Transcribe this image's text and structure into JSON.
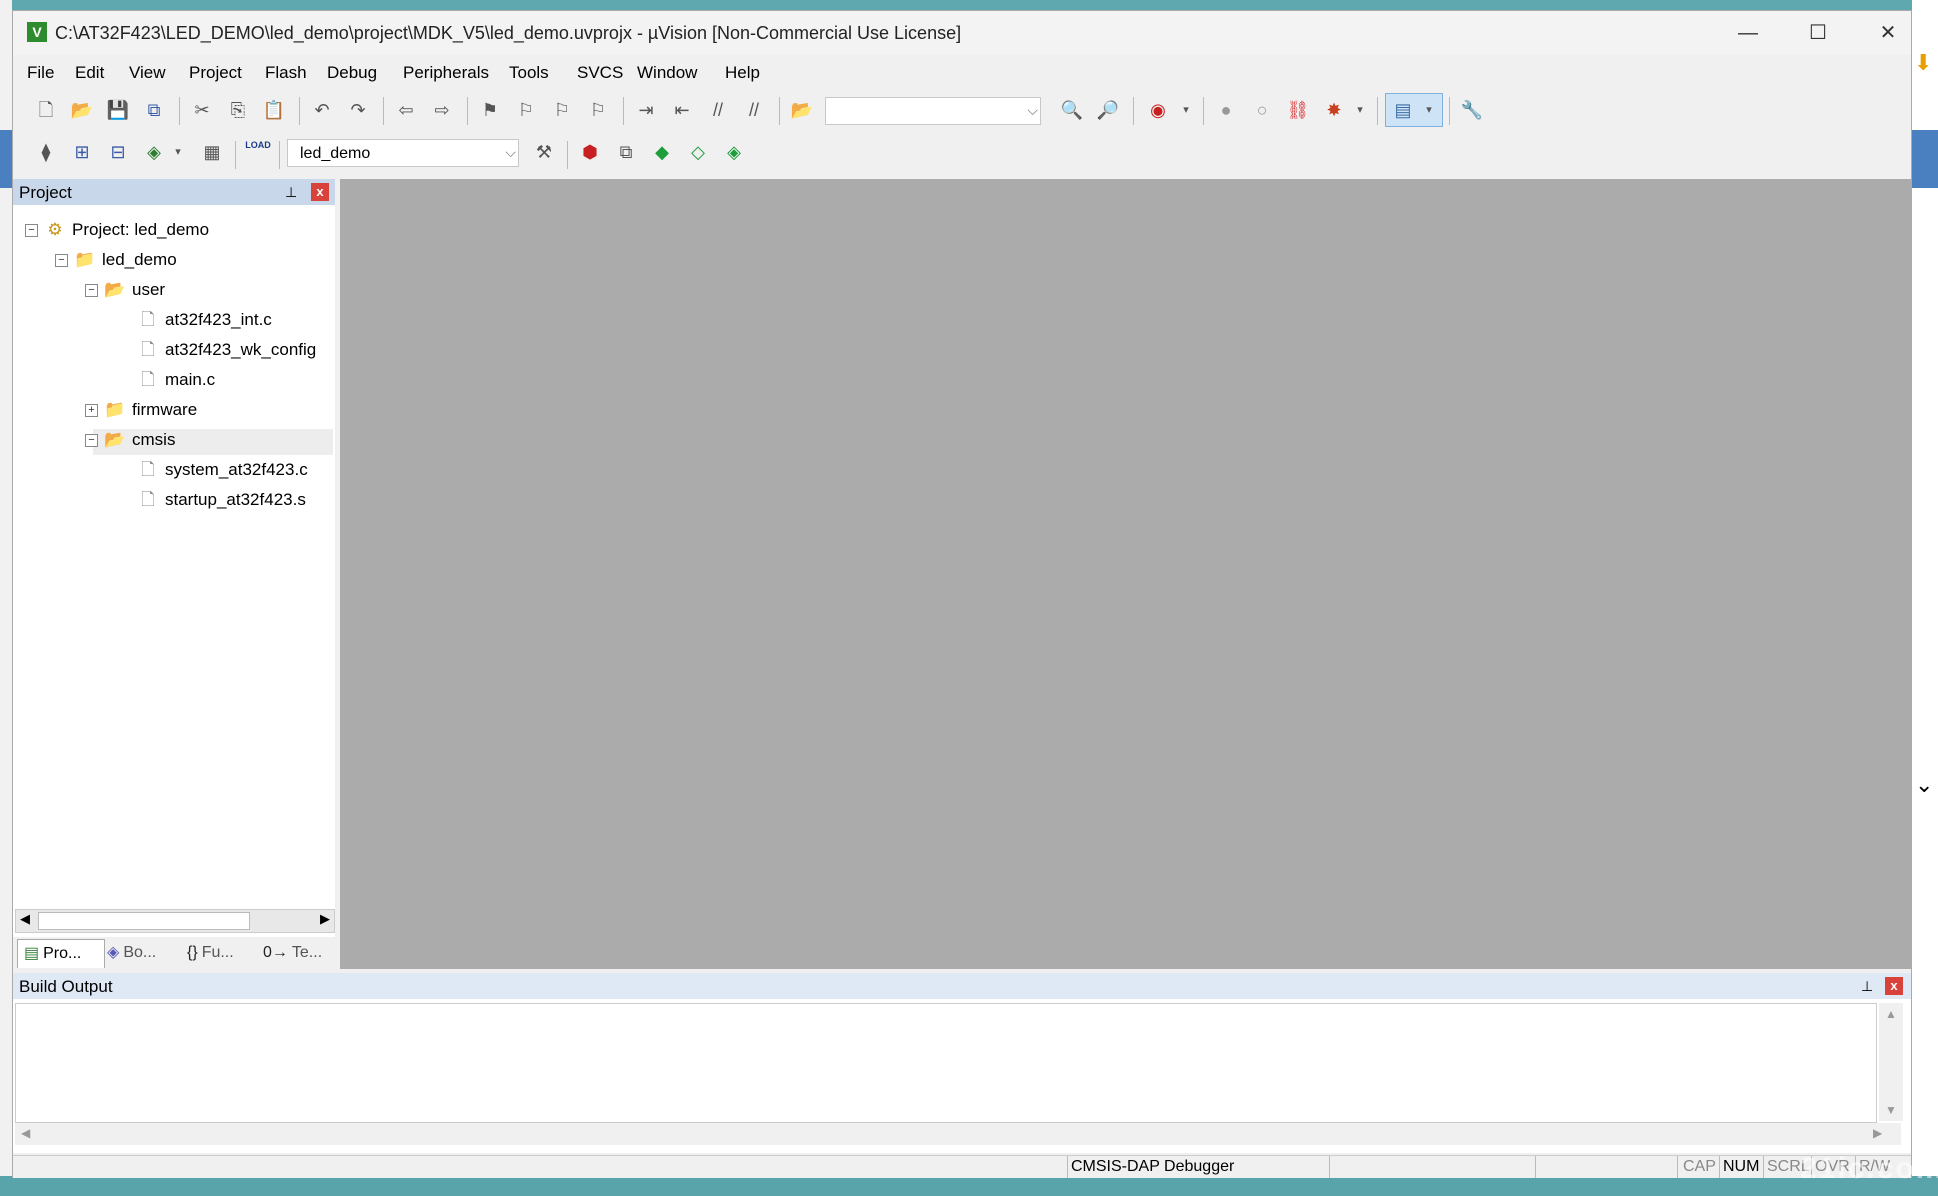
{
  "window": {
    "title": "C:\\AT32F423\\LED_DEMO\\led_demo\\project\\MDK_V5\\led_demo.uvprojx - µVision  [Non-Commercial Use License]",
    "icon": "V",
    "minimize": "—",
    "maximize": "☐",
    "close": "✕"
  },
  "menu": [
    "File",
    "Edit",
    "View",
    "Project",
    "Flash",
    "Debug",
    "Peripherals",
    "Tools",
    "SVCS",
    "Window",
    "Help"
  ],
  "toolbar": {
    "find_combo_value": "",
    "target_combo_value": "led_demo",
    "load_icon_text": "LOAD"
  },
  "project_panel": {
    "title": "Project",
    "pin": "📌",
    "close": "x",
    "tree": [
      {
        "label": "Project: led_demo",
        "exp": "−",
        "level": 0,
        "kind": "project"
      },
      {
        "label": "led_demo",
        "exp": "−",
        "level": 1,
        "kind": "target"
      },
      {
        "label": "user",
        "exp": "−",
        "level": 2,
        "kind": "folder"
      },
      {
        "label": "at32f423_int.c",
        "exp": "",
        "level": 3,
        "kind": "file"
      },
      {
        "label": "at32f423_wk_config",
        "exp": "",
        "level": 3,
        "kind": "file"
      },
      {
        "label": "main.c",
        "exp": "",
        "level": 3,
        "kind": "file"
      },
      {
        "label": "firmware",
        "exp": "+",
        "level": 2,
        "kind": "folder"
      },
      {
        "label": "cmsis",
        "exp": "−",
        "level": 2,
        "kind": "folder"
      },
      {
        "label": "system_at32f423.c",
        "exp": "",
        "level": 3,
        "kind": "file"
      },
      {
        "label": "startup_at32f423.s",
        "exp": "",
        "level": 3,
        "kind": "file"
      }
    ],
    "tabs": [
      {
        "label": "Pro...",
        "icon": "▤"
      },
      {
        "label": "Bo...",
        "icon": "◈"
      },
      {
        "label": "Fu...",
        "icon": "{}"
      },
      {
        "label": "Te...",
        "icon": "0→"
      }
    ]
  },
  "build_output": {
    "title": "Build Output",
    "content": ""
  },
  "status": {
    "debugger": "CMSIS-DAP Debugger",
    "cap": "CAP",
    "num": "NUM",
    "scrl": "SCRL",
    "ovr": "OVR",
    "rw": "R/W"
  },
  "watermark": "21ic.com"
}
